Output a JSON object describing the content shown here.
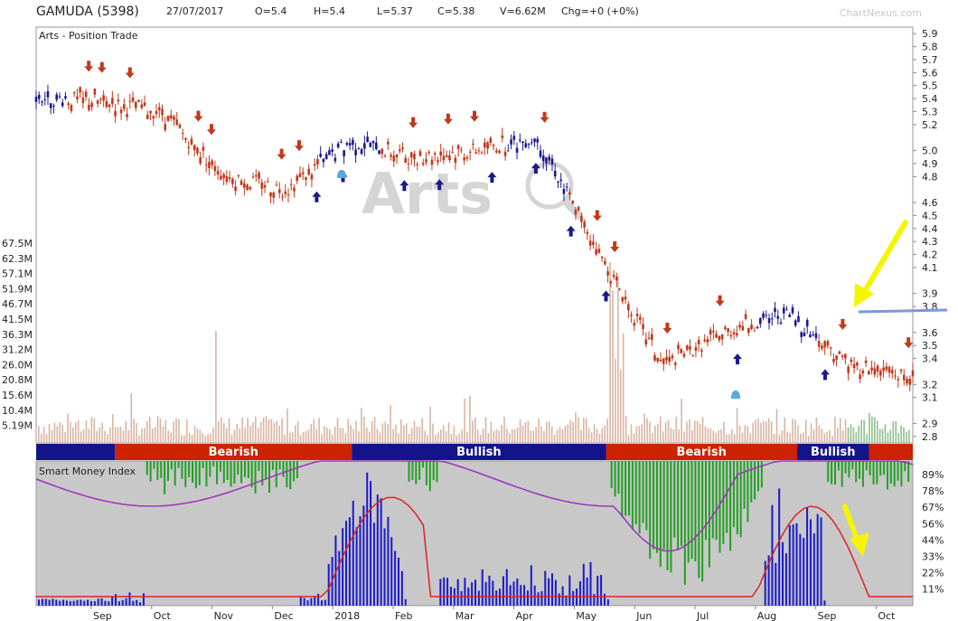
{
  "header": {
    "symbol": "GAMUDA (5398)",
    "date": "27/07/2017",
    "open": "O=5.4",
    "high": "H=5.4",
    "low": "L=5.37",
    "close": "C=5.38",
    "volume": "V=6.62M",
    "change": "Chg=+0 (+0%)",
    "brand": "ChartNexus.com"
  },
  "panels": {
    "price_title": "Arts - Position Trade",
    "smi_title": "Smart Money Index",
    "watermark": "Arts"
  },
  "colors": {
    "bull": "#1a1a8c",
    "bear": "#c0391b",
    "volume": "#d9b5a5",
    "volume_recent": "#8fbf8f",
    "trend_bearish": "#cc2200",
    "trend_bullish": "#14148a",
    "smi_panel_bg": "#c8c8c8",
    "smi_green": "#22a022",
    "smi_blue": "#1a1acc",
    "smi_purple": "#a030c0",
    "smi_red": "#dd2222",
    "annotation_yellow": "#f5f500",
    "annotation_line": "#7a9ad8",
    "bell": "#5aa8e0"
  },
  "chart_data": [
    {
      "type": "candlestick",
      "title": "Arts - Position Trade",
      "x_ticks": [
        "Sep",
        "Oct",
        "Nov",
        "Dec",
        "2018",
        "Feb",
        "Mar",
        "Apr",
        "May",
        "Jun",
        "Jul",
        "Aug",
        "Sep",
        "Oct"
      ],
      "y_ticks": [
        "5.9",
        "5.8",
        "5.7",
        "5.6",
        "5.5",
        "5.4",
        "5.3",
        "5.2",
        "5.0",
        "4.9",
        "4.8",
        "4.6",
        "4.5",
        "4.4",
        "4.3",
        "4.2",
        "4.1",
        "3.9",
        "3.8",
        "3.6",
        "3.5",
        "3.4",
        "3.2",
        "3.1",
        "2.9",
        "2.8"
      ],
      "volume_ticks": [
        "67.5M",
        "62.3M",
        "57.1M",
        "51.9M",
        "46.7M",
        "41.5M",
        "36.3M",
        "31.2M",
        "26.0M",
        "20.8M",
        "15.6M",
        "10.4M",
        "5.19M"
      ],
      "ylim": [
        2.75,
        5.95
      ],
      "price_path": [
        {
          "month": "Aug-2017",
          "close": 5.41,
          "trend": "bull"
        },
        {
          "month": "Sep-2017",
          "close": 5.38,
          "trend": "bear"
        },
        {
          "month": "Oct-2017",
          "close": 5.29,
          "trend": "bear"
        },
        {
          "month": "Nov-2017",
          "close": 4.8,
          "trend": "bear"
        },
        {
          "month": "Dec-2017",
          "close": 4.7,
          "trend": "bear"
        },
        {
          "month": "Jan-2018",
          "close": 5.07,
          "trend": "bull"
        },
        {
          "month": "Feb-2018",
          "close": 4.95,
          "trend": "bear"
        },
        {
          "month": "Mar-2018",
          "close": 5.0,
          "trend": "bear"
        },
        {
          "month": "Apr-2018",
          "close": 5.1,
          "trend": "bull"
        },
        {
          "month": "May-2018",
          "close": 4.2,
          "trend": "bear"
        },
        {
          "month": "Jun-2018",
          "close": 3.35,
          "trend": "bear"
        },
        {
          "month": "Jul-2018",
          "close": 3.6,
          "trend": "bear"
        },
        {
          "month": "Aug-2018",
          "close": 3.75,
          "trend": "bull"
        },
        {
          "month": "Sep-2018",
          "close": 3.35,
          "trend": "bear"
        },
        {
          "month": "Oct-2018",
          "close": 3.25,
          "trend": "bear"
        }
      ],
      "trend_bar": [
        {
          "label": "",
          "state": "bullish",
          "from": 0.0,
          "to": 0.09
        },
        {
          "label": "Bearish",
          "state": "bearish",
          "from": 0.09,
          "to": 0.36
        },
        {
          "label": "Bullish",
          "state": "bullish",
          "from": 0.36,
          "to": 0.65
        },
        {
          "label": "Bearish",
          "state": "bearish",
          "from": 0.65,
          "to": 0.868
        },
        {
          "label": "Bullish",
          "state": "bullish",
          "from": 0.868,
          "to": 0.95
        },
        {
          "label": "",
          "state": "bearish",
          "from": 0.95,
          "to": 1.0
        }
      ]
    },
    {
      "type": "bar",
      "title": "Smart Money Index",
      "y_ticks": [
        "89%",
        "78%",
        "67%",
        "56%",
        "44%",
        "33%",
        "22%",
        "11%"
      ],
      "ylim": [
        0,
        100
      ]
    }
  ]
}
